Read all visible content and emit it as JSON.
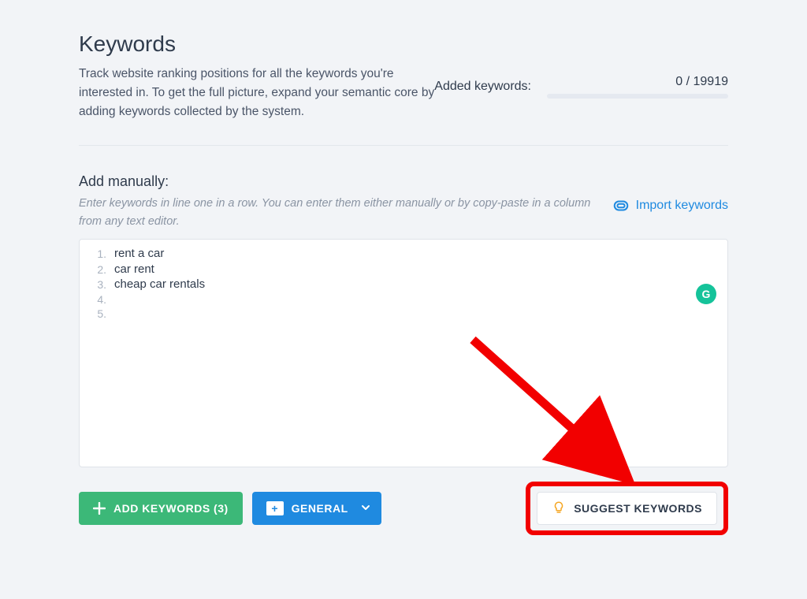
{
  "header": {
    "title": "Keywords",
    "subtitle": "Track website ranking positions for all the keywords you're interested in. To get the full picture, expand your semantic core by adding keywords collected by the system.",
    "added_label": "Added keywords:",
    "added_count": "0 / 19919"
  },
  "manual": {
    "title": "Add manually:",
    "hint": "Enter keywords in line one in a row. You can enter them either manually or by copy-paste in a column from any text editor.",
    "import_label": "Import keywords"
  },
  "editor": {
    "lines": [
      "rent a car",
      "car rent",
      "cheap car rentals",
      "",
      ""
    ]
  },
  "actions": {
    "add_label": "ADD KEYWORDS (3)",
    "general_label": "GENERAL",
    "suggest_label": "SUGGEST KEYWORDS"
  },
  "grammarly_badge": "G"
}
